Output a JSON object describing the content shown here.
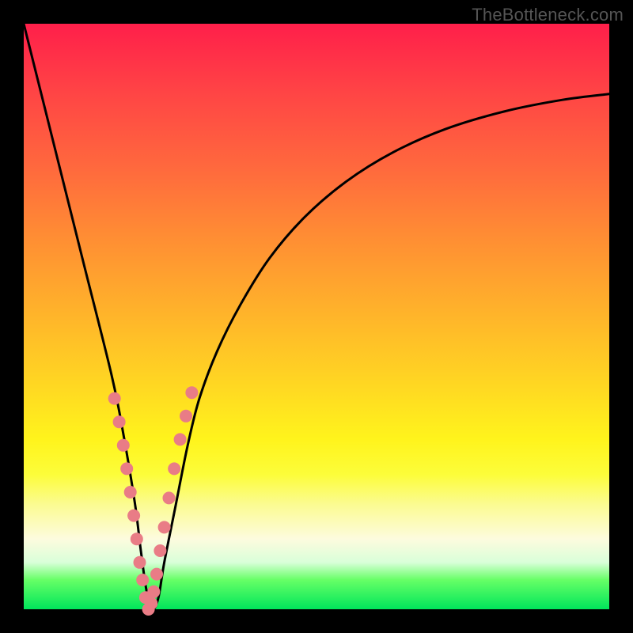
{
  "watermark": "TheBottleneck.com",
  "chart_data": {
    "type": "line",
    "title": "",
    "xlabel": "",
    "ylabel": "",
    "xlim": [
      0,
      100
    ],
    "ylim": [
      0,
      100
    ],
    "series": [
      {
        "name": "bottleneck-curve",
        "x": [
          0,
          5,
          10,
          15,
          17,
          19,
          20,
          21,
          22,
          23,
          24,
          26,
          28,
          30,
          33,
          37,
          42,
          48,
          55,
          63,
          72,
          82,
          92,
          100
        ],
        "values": [
          100,
          80,
          60,
          40,
          30,
          18,
          10,
          3,
          0,
          2,
          8,
          18,
          28,
          36,
          44,
          52,
          60,
          67,
          73,
          78,
          82,
          85,
          87,
          88
        ]
      }
    ],
    "markers": {
      "name": "highlighted-range",
      "color": "#e97c86",
      "x": [
        15.5,
        16.3,
        17.0,
        17.6,
        18.2,
        18.8,
        19.3,
        19.8,
        20.3,
        20.8,
        21.3,
        21.8,
        22.2,
        22.7,
        23.3,
        24.0,
        24.8,
        25.7,
        26.7,
        27.7,
        28.7
      ],
      "values": [
        36,
        32,
        28,
        24,
        20,
        16,
        12,
        8,
        5,
        2,
        0,
        1,
        3,
        6,
        10,
        14,
        19,
        24,
        29,
        33,
        37
      ]
    },
    "background": "vertical-gradient-red-to-green",
    "annotations": []
  }
}
